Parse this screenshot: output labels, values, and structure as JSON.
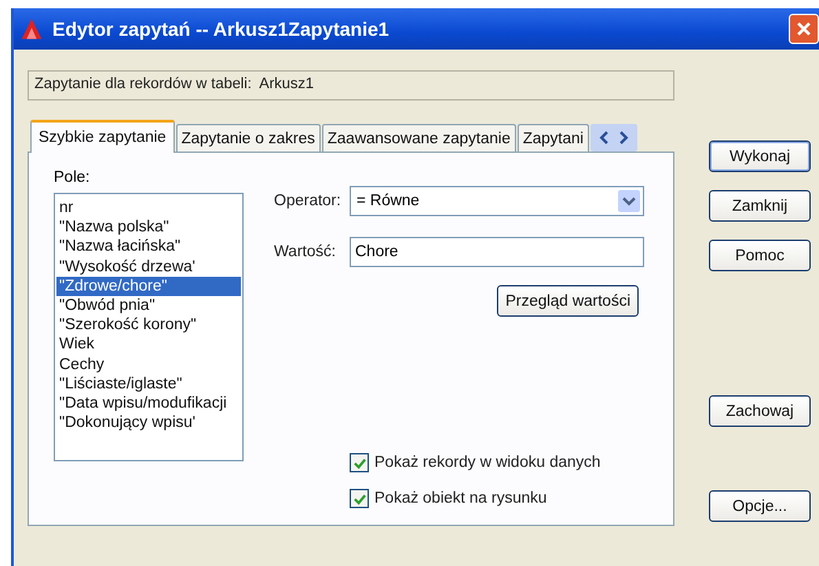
{
  "window": {
    "title": "Edytor zapytań -- Arkusz1Zapytanie1"
  },
  "info": "Zapytanie dla rekordów w tabeli:  Arkusz1",
  "tabs": [
    {
      "label": "Szybkie zapytanie",
      "selected": true
    },
    {
      "label": "Zapytanie o zakres",
      "selected": false
    },
    {
      "label": "Zaawansowane zapytanie",
      "selected": false
    },
    {
      "label": "Zapytani",
      "selected": false
    }
  ],
  "fields": {
    "label": "Pole:",
    "items": [
      {
        "label": "nr",
        "selected": false
      },
      {
        "label": "\"Nazwa polska\"",
        "selected": false
      },
      {
        "label": "\"Nazwa łacińska\"",
        "selected": false
      },
      {
        "label": "\"Wysokość drzewa'",
        "selected": false
      },
      {
        "label": "\"Zdrowe/chore\"",
        "selected": true
      },
      {
        "label": "\"Obwód pnia\"",
        "selected": false
      },
      {
        "label": "\"Szerokość korony\"",
        "selected": false
      },
      {
        "label": "Wiek",
        "selected": false
      },
      {
        "label": "Cechy",
        "selected": false
      },
      {
        "label": "\"Liściaste/iglaste\"",
        "selected": false
      },
      {
        "label": "\"Data wpisu/modufikacji",
        "selected": false
      },
      {
        "label": "\"Dokonujący wpisu'",
        "selected": false
      }
    ]
  },
  "operator": {
    "label": "Operator:",
    "value": "=   Równe"
  },
  "value": {
    "label": "Wartość:",
    "value": "Chore"
  },
  "browse_button": "Przegląd wartości",
  "checkboxes": [
    {
      "label": "Pokaż rekordy w widoku danych",
      "checked": true
    },
    {
      "label": "Pokaż obiekt na rysunku",
      "checked": true
    }
  ],
  "buttons": [
    {
      "label": "Wykonaj",
      "default": true
    },
    {
      "label": "Zamknij",
      "default": false
    },
    {
      "label": "Pomoc",
      "default": false
    },
    {
      "label": "Zachowaj",
      "default": false
    },
    {
      "label": "Opcje...",
      "default": false
    }
  ]
}
